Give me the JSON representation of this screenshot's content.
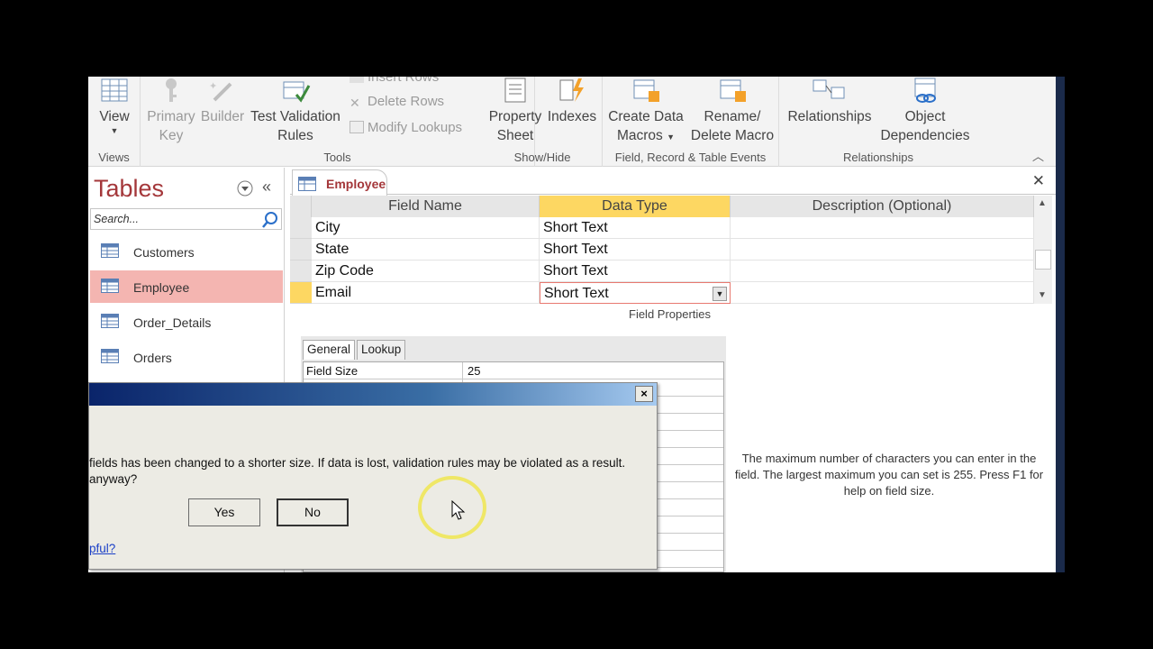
{
  "ribbon": {
    "views": {
      "view_label": "View",
      "group": "Views"
    },
    "tools": {
      "primary_key": [
        "Primary",
        "Key"
      ],
      "builder": "Builder",
      "test_validation": [
        "Test Validation",
        "Rules"
      ],
      "insert_rows": "Insert Rows",
      "delete_rows": "Delete Rows",
      "modify_lookups": "Modify Lookups",
      "group": "Tools"
    },
    "show_hide": {
      "property_sheet": [
        "Property",
        "Sheet"
      ],
      "indexes": "Indexes",
      "group": "Show/Hide"
    },
    "events": {
      "create_data_macros": [
        "Create Data",
        "Macros"
      ],
      "rename_delete_macro": [
        "Rename/",
        "Delete Macro"
      ],
      "group": "Field, Record & Table Events"
    },
    "relationships": {
      "relationships": "Relationships",
      "object_dependencies": [
        "Object",
        "Dependencies"
      ],
      "group": "Relationships"
    }
  },
  "nav": {
    "title": "Tables",
    "search_placeholder": "Search...",
    "items": [
      {
        "label": "Customers"
      },
      {
        "label": "Employee"
      },
      {
        "label": "Order_Details"
      },
      {
        "label": "Orders"
      }
    ]
  },
  "doc": {
    "tab_label": "Employee",
    "columns": [
      "Field Name",
      "Data Type",
      "Description (Optional)"
    ],
    "rows": [
      {
        "field": "City",
        "type": "Short Text"
      },
      {
        "field": "State",
        "type": "Short Text"
      },
      {
        "field": "Zip Code",
        "type": "Short Text"
      },
      {
        "field": "Email",
        "type": "Short Text"
      }
    ],
    "field_properties_title": "Field Properties",
    "prop_tabs": [
      "General",
      "Lookup"
    ],
    "props": [
      {
        "key": "Field Size",
        "value": "25"
      }
    ],
    "hint": "The maximum number of characters you can enter in the field. The largest maximum you can set is 255. Press F1 for help on field size."
  },
  "dialog": {
    "message_line1": "fields has been changed to a shorter size. If data is lost, validation rules may be violated as a result.",
    "message_line2": "anyway?",
    "yes": "Yes",
    "no": "No",
    "help_link": "pful?",
    "close": "×"
  },
  "colors": {
    "access_red": "#a4373a",
    "selected_nav": "#f4b5b1",
    "active_header": "#fdd762"
  }
}
